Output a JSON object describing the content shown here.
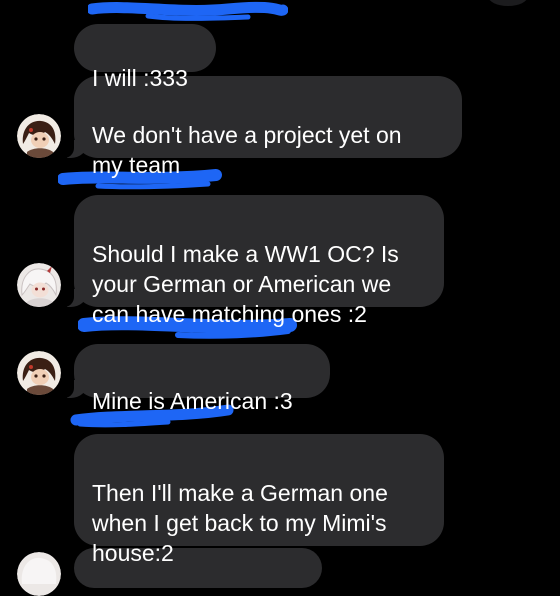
{
  "colors": {
    "background": "#000000",
    "incoming_bubble": "#2c2c2e",
    "text": "#ffffff",
    "redaction": "#1e66f5"
  },
  "messages": [
    {
      "id": "m1",
      "text": "I will :333"
    },
    {
      "id": "m2",
      "text": "We don't have a project yet on\nmy team"
    },
    {
      "id": "m3",
      "text": "Should I make a WW1 OC? Is\nyour German or American we\ncan have matching ones :2"
    },
    {
      "id": "m4",
      "text": "Mine is American :3"
    },
    {
      "id": "m5",
      "text": "Then I'll make a German one\nwhen I get back to my Mimi's\nhouse:2"
    }
  ],
  "avatars": [
    {
      "icon": "dark-haired-anime-character-avatar"
    },
    {
      "icon": "white-haired-anime-character-avatar"
    },
    {
      "icon": "dark-haired-anime-character-avatar"
    }
  ],
  "redactions": [
    {
      "icon": "blue-scribble-redaction"
    },
    {
      "icon": "blue-scribble-redaction"
    },
    {
      "icon": "blue-scribble-redaction"
    },
    {
      "icon": "blue-scribble-redaction"
    }
  ]
}
